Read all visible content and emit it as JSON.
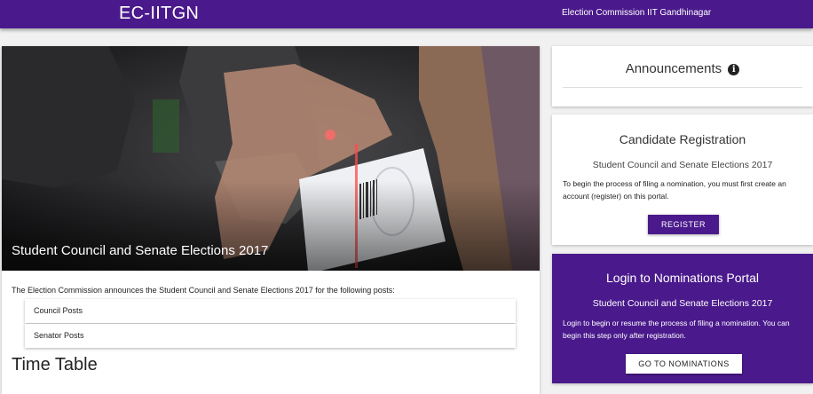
{
  "navbar": {
    "brand": "EC-IITGN",
    "link": "Election Commission IIT Gandhinagar"
  },
  "hero": {
    "title": "Student Council and Senate Elections 2017"
  },
  "main": {
    "intro": "The Election Commission announces the Student Council and Senate Elections 2017 for the following posts:",
    "posts": [
      "Council Posts",
      "Senator Posts"
    ],
    "timetable_heading": "Time Table"
  },
  "announcements": {
    "title": "Announcements",
    "icon": "info-icon"
  },
  "registration": {
    "title": "Candidate Registration",
    "subtitle": "Student Council and Senate Elections 2017",
    "text": "To begin the process of filing a nomination, you must first create an account (register) on this portal.",
    "button": "REGISTER"
  },
  "login": {
    "title": "Login to Nominations Portal",
    "subtitle": "Student Council and Senate Elections 2017",
    "text": "Login to begin or resume the process of filing a nomination. You can begin this step only after registration.",
    "button": "GO TO NOMINATIONS"
  },
  "colors": {
    "primary": "#4a1a8c",
    "background": "#f1f1f1"
  }
}
